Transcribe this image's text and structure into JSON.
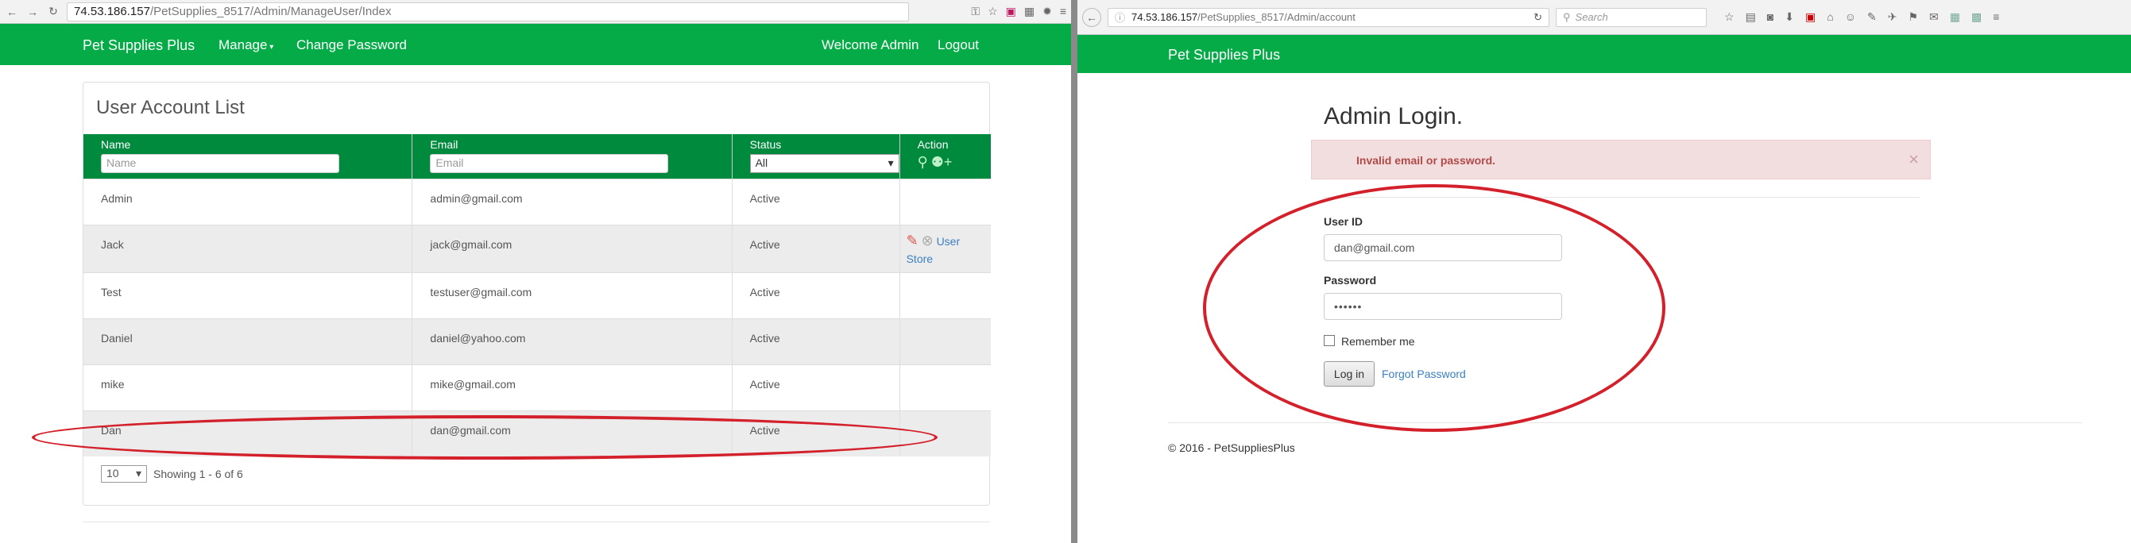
{
  "left": {
    "url_host": "74.53.186.157",
    "url_path": "/PetSupplies_8517/Admin/ManageUser/Index",
    "nav": {
      "brand": "Pet Supplies Plus",
      "manage": "Manage",
      "change_password": "Change Password",
      "welcome": "Welcome Admin",
      "logout": "Logout"
    },
    "panel_title": "User Account List",
    "columns": [
      "Name",
      "Email",
      "Status",
      "Action"
    ],
    "filters": {
      "name_placeholder": "Name",
      "email_placeholder": "Email",
      "status_selected": "All"
    },
    "rows": [
      {
        "name": "Admin",
        "email": "admin@gmail.com",
        "status": "Active"
      },
      {
        "name": "Jack",
        "email": "jack@gmail.com",
        "status": "Active",
        "action_link_1": "User",
        "action_link_2": "Store"
      },
      {
        "name": "Test",
        "email": "testuser@gmail.com",
        "status": "Active"
      },
      {
        "name": "Daniel",
        "email": "daniel@yahoo.com",
        "status": "Active"
      },
      {
        "name": "mike",
        "email": "mike@gmail.com",
        "status": "Active"
      },
      {
        "name": "Dan",
        "email": "dan@gmail.com",
        "status": "Active"
      }
    ],
    "page_size": "10",
    "showing": "Showing 1 - 6 of 6"
  },
  "right": {
    "url_host": "74.53.186.157",
    "url_path": "/PetSupplies_8517/Admin/account",
    "search_placeholder": "Search",
    "nav": {
      "brand": "Pet Supplies Plus"
    },
    "heading": "Admin Login.",
    "alert": "Invalid email or password.",
    "alert_close": "×",
    "userid_label": "User ID",
    "userid_value": "dan@gmail.com",
    "password_label": "Password",
    "password_value": "••••••",
    "remember_label": "Remember me",
    "login_button": "Log in",
    "forgot_link": "Forgot Password",
    "footer": "© 2016 - PetSuppliesPlus"
  },
  "colors": {
    "nav_green": "#04ab47",
    "header_green": "#008a3e",
    "annotation_red": "#d3202a",
    "alert_bg": "#f2dede"
  }
}
